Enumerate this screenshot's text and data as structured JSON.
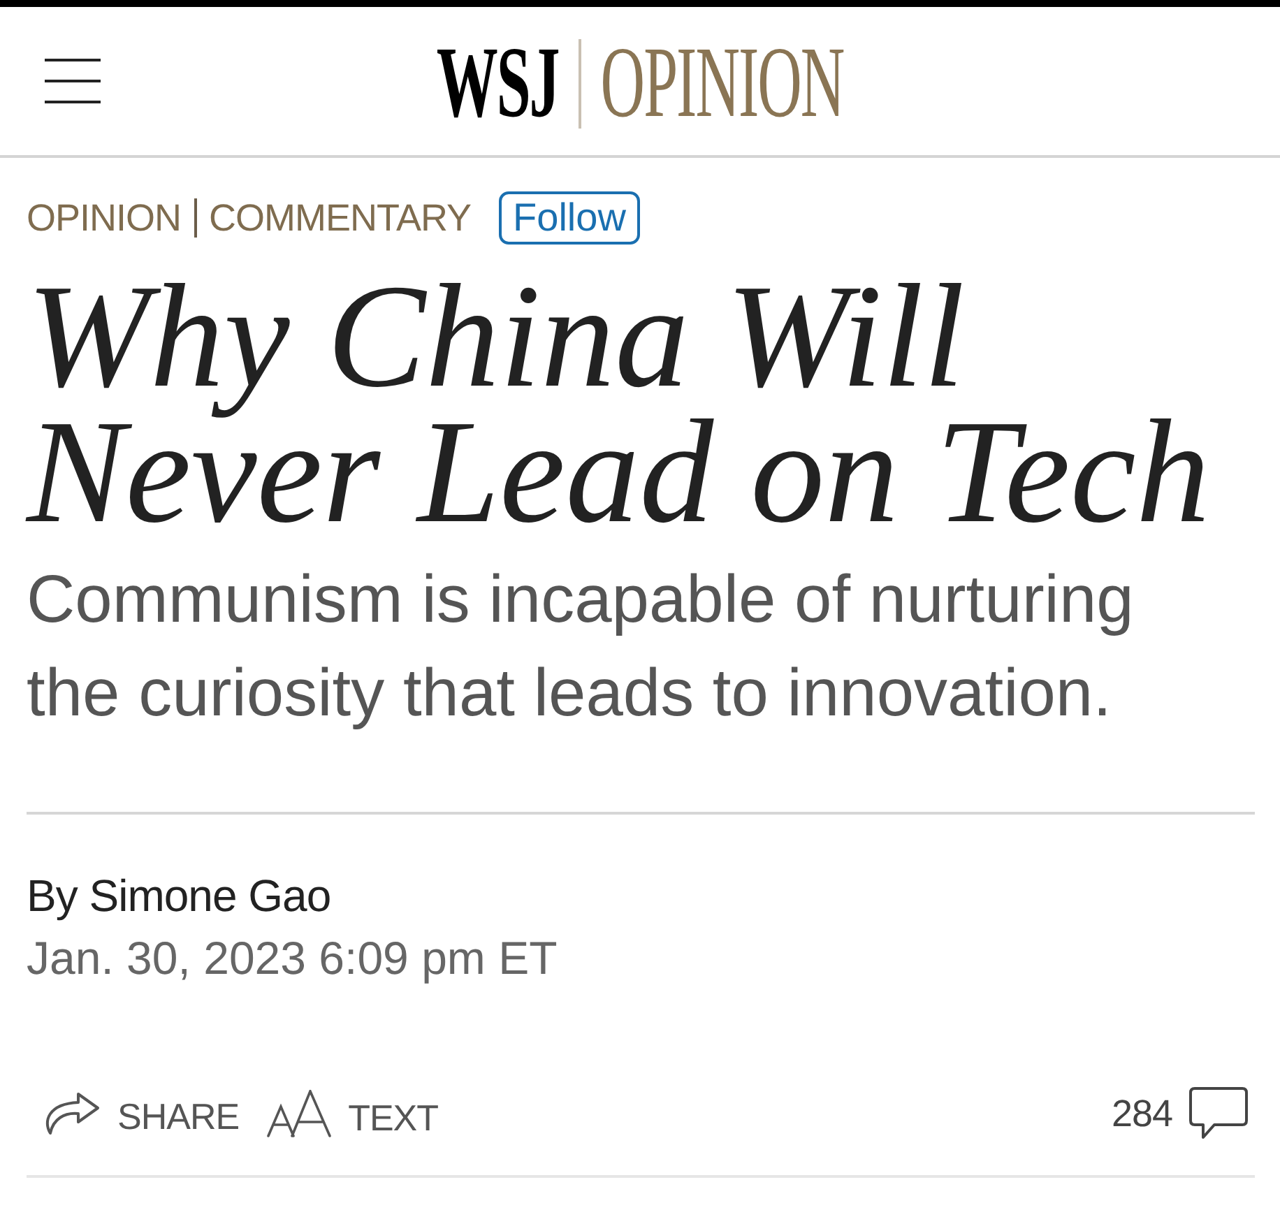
{
  "masthead": {
    "brand": "WSJ",
    "section": "OPINION"
  },
  "article": {
    "section_labels": [
      "OPINION",
      "COMMENTARY"
    ],
    "follow_button": {
      "label": "Follow"
    },
    "headline": "Why China Will Never Lead on Tech",
    "subheadline": "Communism is incapable of nurturing the curiosity that leads to innovation.",
    "byline": "By Simone Gao",
    "timestamp": "Jan. 30, 2023 6:09 pm ET"
  },
  "actions": [
    {
      "kind": "share",
      "label": "SHARE"
    },
    {
      "kind": "text_size",
      "label": "TEXT"
    }
  ],
  "comments": {
    "count": "284"
  }
}
